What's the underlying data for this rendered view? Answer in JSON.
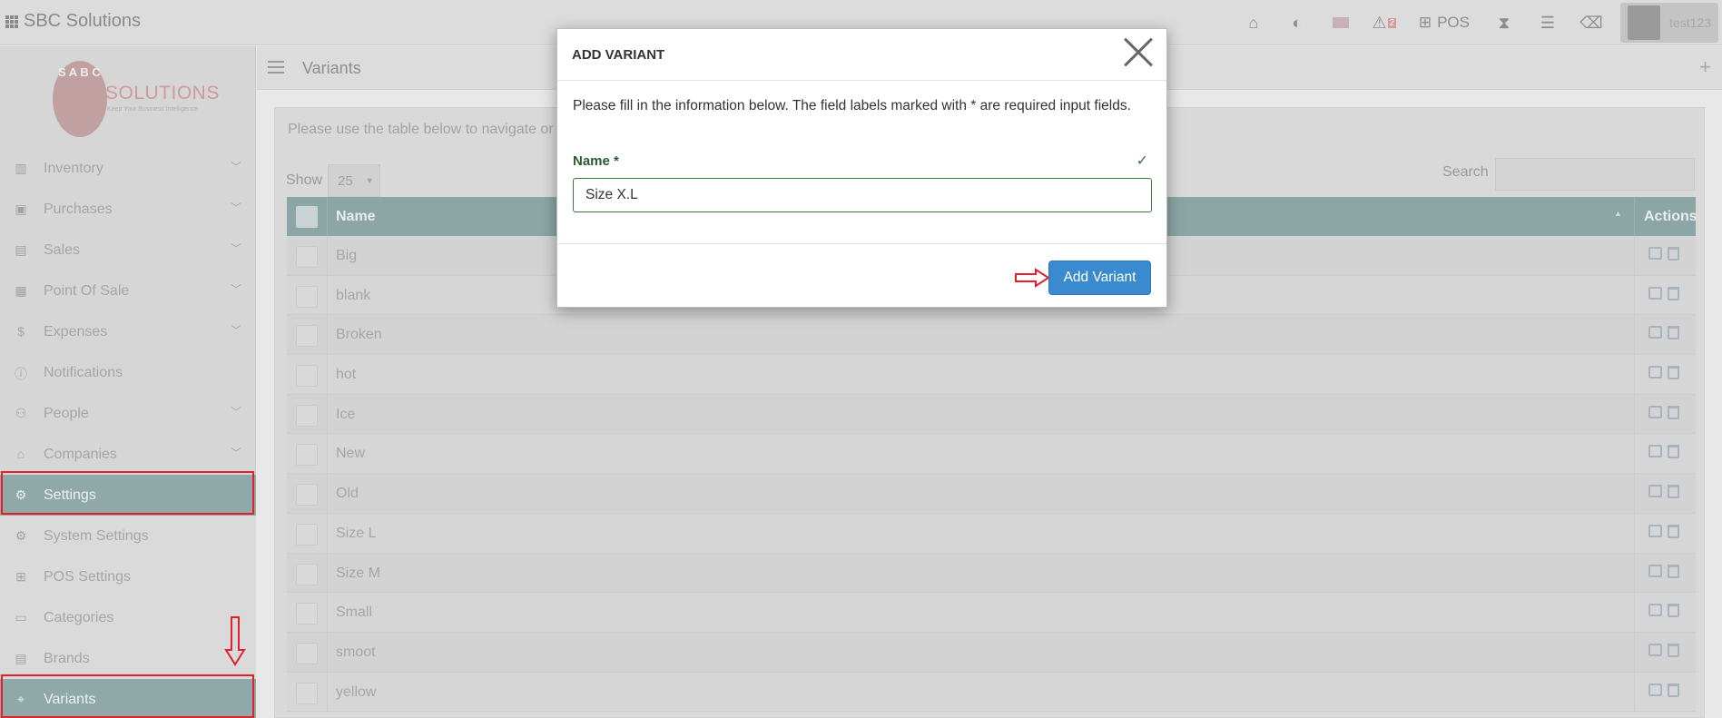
{
  "app": {
    "brand": "SBC Solutions"
  },
  "topbar": {
    "pos_label": "POS",
    "alerts_count": "2",
    "user_name": "test123",
    "icons": [
      "home-icon",
      "contrast-icon",
      "flag-icon",
      "warning-icon",
      "pos-grid-icon",
      "hourglass-icon",
      "list-icon",
      "eraser-icon"
    ]
  },
  "logo": {
    "letters": "S A B C",
    "title": "SOLUTIONS",
    "tagline": "Keep Your Business Intelligence"
  },
  "sidebar": {
    "items": [
      {
        "label": "Inventory",
        "icon": "barcode-icon",
        "chevron": true
      },
      {
        "label": "Purchases",
        "icon": "money-icon",
        "chevron": true
      },
      {
        "label": "Sales",
        "icon": "receipt-icon",
        "chevron": true
      },
      {
        "label": "Point Of Sale",
        "icon": "register-icon",
        "chevron": true
      },
      {
        "label": "Expenses",
        "icon": "dollar-icon",
        "chevron": true
      },
      {
        "label": "Notifications",
        "icon": "info-icon",
        "chevron": false
      },
      {
        "label": "People",
        "icon": "users-icon",
        "chevron": true
      },
      {
        "label": "Companies",
        "icon": "building-icon",
        "chevron": true
      },
      {
        "label": "Settings",
        "icon": "cog-icon",
        "chevron": false,
        "active": true
      },
      {
        "label": "System Settings",
        "icon": "cogs-icon",
        "chevron": false,
        "sub": true
      },
      {
        "label": "POS Settings",
        "icon": "grid-icon",
        "chevron": false,
        "sub": true
      },
      {
        "label": "Categories",
        "icon": "folder-icon",
        "chevron": false,
        "sub": true
      },
      {
        "label": "Brands",
        "icon": "table-icon",
        "chevron": false,
        "sub": true
      },
      {
        "label": "Variants",
        "icon": "tags-icon",
        "chevron": false,
        "active": true
      }
    ]
  },
  "page": {
    "title": "Variants",
    "intro": "Please use the table below to navigate or",
    "show_label": "Show",
    "show_value": "25",
    "search_label": "Search",
    "columns": {
      "name": "Name",
      "actions": "Actions"
    },
    "rows": [
      "Big",
      "blank",
      "Broken",
      "hot",
      "Ice",
      "New",
      "Old",
      "Size L",
      "Size M",
      "Small",
      "smoot",
      "yellow"
    ]
  },
  "modal": {
    "title": "ADD VARIANT",
    "intro": "Please fill in the information below. The field labels marked with * are required input fields.",
    "name_label": "Name *",
    "name_value": "Size X.L",
    "submit_label": "Add Variant"
  },
  "colors": {
    "accent": "#3a8ad0",
    "annotation": "#e41e2a",
    "valid": "#3d7a3e"
  }
}
